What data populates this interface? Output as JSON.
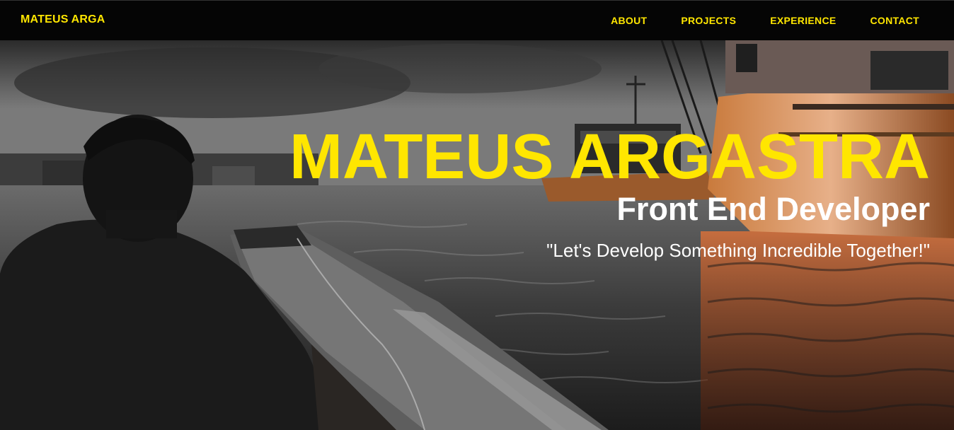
{
  "nav": {
    "brand": "MATEUS ARGA",
    "links": [
      "ABOUT",
      "PROJECTS",
      "EXPERIENCE",
      "CONTACT"
    ]
  },
  "hero": {
    "name": "MATEUS ARGASTRA",
    "role": "Front End Developer",
    "quote": "\"Let's Develop Something Incredible Together!\""
  },
  "colors": {
    "accent": "#FFE600",
    "nav_background": "#050505",
    "text_light": "#FFFFFF"
  }
}
